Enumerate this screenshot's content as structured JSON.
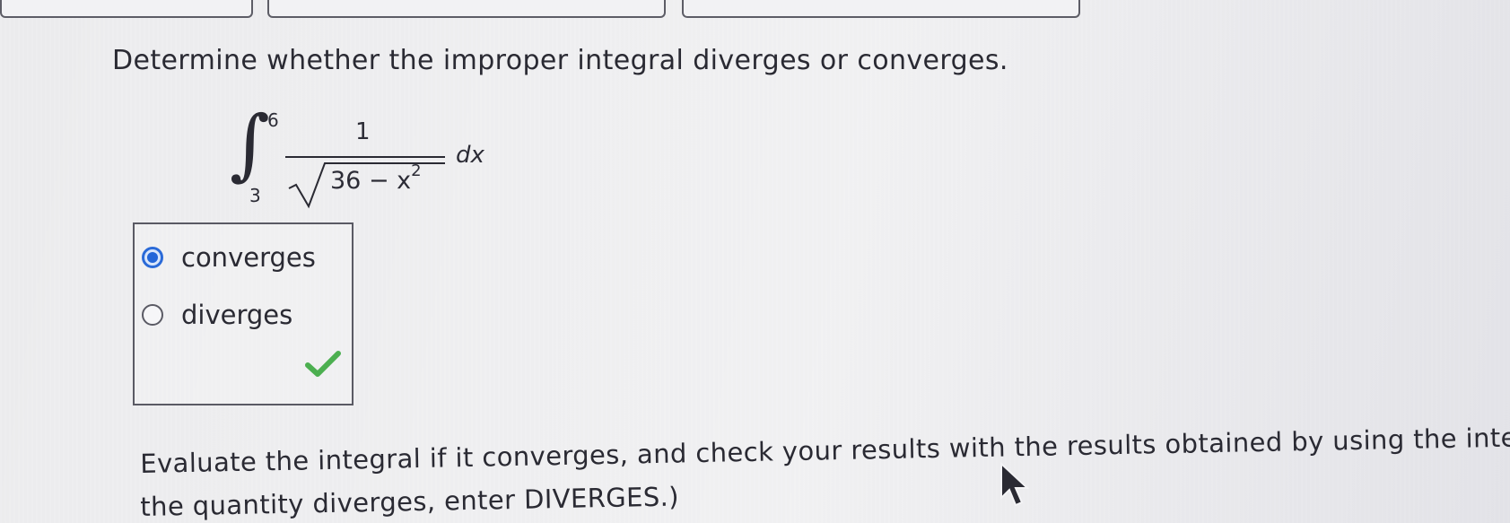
{
  "question": {
    "text": "Determine whether the improper integral diverges or converges."
  },
  "integral": {
    "upper_limit": "6",
    "lower_limit": "3",
    "numerator": "1",
    "radicand_base": "36 − x",
    "radicand_exponent": "2",
    "differential": "dx"
  },
  "answer_choices": {
    "options": [
      {
        "label": "converges",
        "selected": true
      },
      {
        "label": "diverges",
        "selected": false
      }
    ],
    "result_icon": "check-icon",
    "result_color": "#4caf50",
    "selected_color": "#2466d8"
  },
  "followup": {
    "line1": "Evaluate the integral if it converges, and check your results with the results obtained by using the inte",
    "line2": "the quantity diverges, enter DIVERGES.)"
  }
}
